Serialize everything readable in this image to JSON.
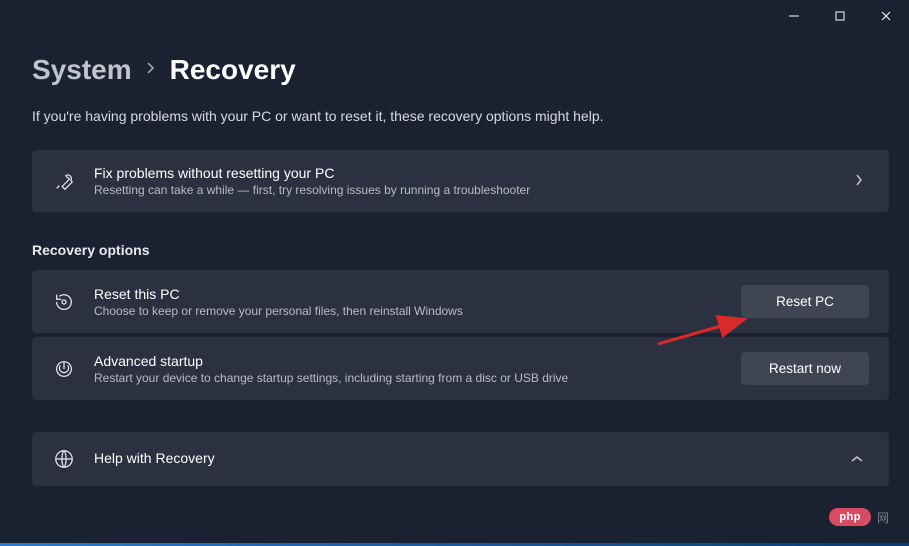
{
  "titlebar": {
    "minimize": "minimize",
    "maximize": "maximize",
    "close": "close"
  },
  "breadcrumb": {
    "parent": "System",
    "current": "Recovery"
  },
  "subtitle": "If you're having problems with your PC or want to reset it, these recovery options might help.",
  "fix": {
    "title": "Fix problems without resetting your PC",
    "sub": "Resetting can take a while — first, try resolving issues by running a troubleshooter"
  },
  "section_header": "Recovery options",
  "reset": {
    "title": "Reset this PC",
    "sub": "Choose to keep or remove your personal files, then reinstall Windows",
    "button": "Reset PC"
  },
  "advanced": {
    "title": "Advanced startup",
    "sub": "Restart your device to change startup settings, including starting from a disc or USB drive",
    "button": "Restart now"
  },
  "help": {
    "title": "Help with Recovery"
  },
  "watermark": {
    "badge": "php",
    "text": "网"
  }
}
